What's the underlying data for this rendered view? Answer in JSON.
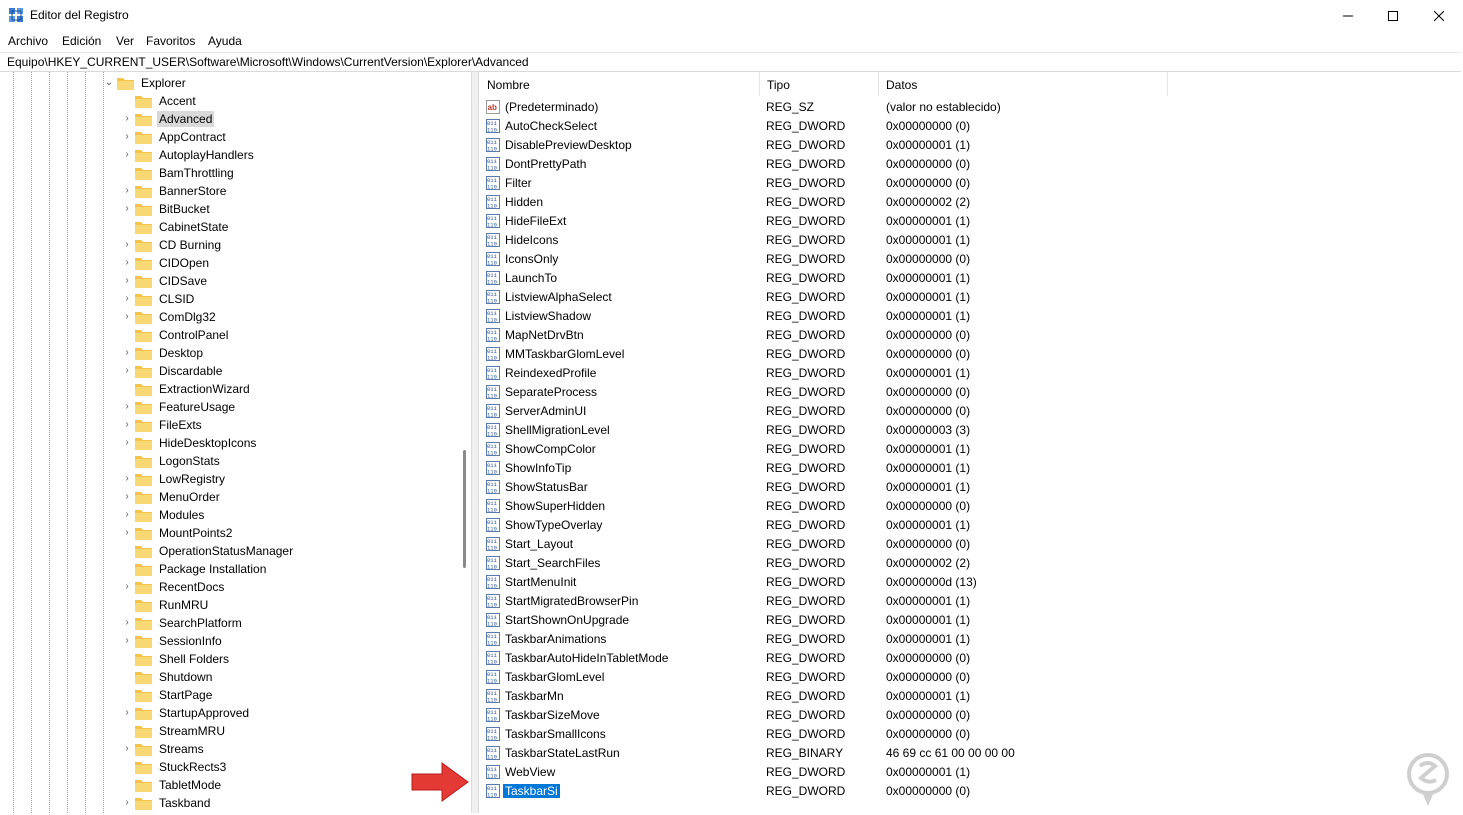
{
  "window": {
    "title": "Editor del Registro",
    "icons": {
      "app": "registry-icon",
      "minimize": "minimize-icon",
      "maximize": "maximize-icon",
      "close": "close-icon"
    }
  },
  "menu": [
    "Archivo",
    "Edición",
    "Ver",
    "Favoritos",
    "Ayuda"
  ],
  "address": "Equipo\\HKEY_CURRENT_USER\\Software\\Microsoft\\Windows\\CurrentVersion\\Explorer\\Advanced",
  "tree": {
    "parent": "Explorer",
    "selected": "Advanced",
    "items": [
      {
        "label": "Accent",
        "expandable": false
      },
      {
        "label": "Advanced",
        "expandable": true
      },
      {
        "label": "AppContract",
        "expandable": true
      },
      {
        "label": "AutoplayHandlers",
        "expandable": true
      },
      {
        "label": "BamThrottling",
        "expandable": false
      },
      {
        "label": "BannerStore",
        "expandable": true
      },
      {
        "label": "BitBucket",
        "expandable": true
      },
      {
        "label": "CabinetState",
        "expandable": false
      },
      {
        "label": "CD Burning",
        "expandable": true
      },
      {
        "label": "CIDOpen",
        "expandable": true
      },
      {
        "label": "CIDSave",
        "expandable": true
      },
      {
        "label": "CLSID",
        "expandable": true
      },
      {
        "label": "ComDlg32",
        "expandable": true
      },
      {
        "label": "ControlPanel",
        "expandable": false
      },
      {
        "label": "Desktop",
        "expandable": true
      },
      {
        "label": "Discardable",
        "expandable": true
      },
      {
        "label": "ExtractionWizard",
        "expandable": false
      },
      {
        "label": "FeatureUsage",
        "expandable": true
      },
      {
        "label": "FileExts",
        "expandable": true
      },
      {
        "label": "HideDesktopIcons",
        "expandable": true
      },
      {
        "label": "LogonStats",
        "expandable": false
      },
      {
        "label": "LowRegistry",
        "expandable": true
      },
      {
        "label": "MenuOrder",
        "expandable": true
      },
      {
        "label": "Modules",
        "expandable": true
      },
      {
        "label": "MountPoints2",
        "expandable": true
      },
      {
        "label": "OperationStatusManager",
        "expandable": false
      },
      {
        "label": "Package Installation",
        "expandable": false
      },
      {
        "label": "RecentDocs",
        "expandable": true
      },
      {
        "label": "RunMRU",
        "expandable": false
      },
      {
        "label": "SearchPlatform",
        "expandable": true
      },
      {
        "label": "SessionInfo",
        "expandable": true
      },
      {
        "label": "Shell Folders",
        "expandable": false
      },
      {
        "label": "Shutdown",
        "expandable": false
      },
      {
        "label": "StartPage",
        "expandable": false
      },
      {
        "label": "StartupApproved",
        "expandable": true
      },
      {
        "label": "StreamMRU",
        "expandable": false
      },
      {
        "label": "Streams",
        "expandable": true
      },
      {
        "label": "StuckRects3",
        "expandable": false
      },
      {
        "label": "TabletMode",
        "expandable": false
      },
      {
        "label": "Taskband",
        "expandable": true
      }
    ]
  },
  "list": {
    "columns": [
      "Nombre",
      "Tipo",
      "Datos"
    ],
    "rows": [
      {
        "name": "(Predeterminado)",
        "type": "REG_SZ",
        "data": "(valor no establecido)",
        "icon": "string-value-icon"
      },
      {
        "name": "AutoCheckSelect",
        "type": "REG_DWORD",
        "data": "0x00000000 (0)",
        "icon": "binary-value-icon"
      },
      {
        "name": "DisablePreviewDesktop",
        "type": "REG_DWORD",
        "data": "0x00000001 (1)",
        "icon": "binary-value-icon"
      },
      {
        "name": "DontPrettyPath",
        "type": "REG_DWORD",
        "data": "0x00000000 (0)",
        "icon": "binary-value-icon"
      },
      {
        "name": "Filter",
        "type": "REG_DWORD",
        "data": "0x00000000 (0)",
        "icon": "binary-value-icon"
      },
      {
        "name": "Hidden",
        "type": "REG_DWORD",
        "data": "0x00000002 (2)",
        "icon": "binary-value-icon"
      },
      {
        "name": "HideFileExt",
        "type": "REG_DWORD",
        "data": "0x00000001 (1)",
        "icon": "binary-value-icon"
      },
      {
        "name": "HideIcons",
        "type": "REG_DWORD",
        "data": "0x00000001 (1)",
        "icon": "binary-value-icon"
      },
      {
        "name": "IconsOnly",
        "type": "REG_DWORD",
        "data": "0x00000000 (0)",
        "icon": "binary-value-icon"
      },
      {
        "name": "LaunchTo",
        "type": "REG_DWORD",
        "data": "0x00000001 (1)",
        "icon": "binary-value-icon"
      },
      {
        "name": "ListviewAlphaSelect",
        "type": "REG_DWORD",
        "data": "0x00000001 (1)",
        "icon": "binary-value-icon"
      },
      {
        "name": "ListviewShadow",
        "type": "REG_DWORD",
        "data": "0x00000001 (1)",
        "icon": "binary-value-icon"
      },
      {
        "name": "MapNetDrvBtn",
        "type": "REG_DWORD",
        "data": "0x00000000 (0)",
        "icon": "binary-value-icon"
      },
      {
        "name": "MMTaskbarGlomLevel",
        "type": "REG_DWORD",
        "data": "0x00000000 (0)",
        "icon": "binary-value-icon"
      },
      {
        "name": "ReindexedProfile",
        "type": "REG_DWORD",
        "data": "0x00000001 (1)",
        "icon": "binary-value-icon"
      },
      {
        "name": "SeparateProcess",
        "type": "REG_DWORD",
        "data": "0x00000000 (0)",
        "icon": "binary-value-icon"
      },
      {
        "name": "ServerAdminUI",
        "type": "REG_DWORD",
        "data": "0x00000000 (0)",
        "icon": "binary-value-icon"
      },
      {
        "name": "ShellMigrationLevel",
        "type": "REG_DWORD",
        "data": "0x00000003 (3)",
        "icon": "binary-value-icon"
      },
      {
        "name": "ShowCompColor",
        "type": "REG_DWORD",
        "data": "0x00000001 (1)",
        "icon": "binary-value-icon"
      },
      {
        "name": "ShowInfoTip",
        "type": "REG_DWORD",
        "data": "0x00000001 (1)",
        "icon": "binary-value-icon"
      },
      {
        "name": "ShowStatusBar",
        "type": "REG_DWORD",
        "data": "0x00000001 (1)",
        "icon": "binary-value-icon"
      },
      {
        "name": "ShowSuperHidden",
        "type": "REG_DWORD",
        "data": "0x00000000 (0)",
        "icon": "binary-value-icon"
      },
      {
        "name": "ShowTypeOverlay",
        "type": "REG_DWORD",
        "data": "0x00000001 (1)",
        "icon": "binary-value-icon"
      },
      {
        "name": "Start_Layout",
        "type": "REG_DWORD",
        "data": "0x00000000 (0)",
        "icon": "binary-value-icon"
      },
      {
        "name": "Start_SearchFiles",
        "type": "REG_DWORD",
        "data": "0x00000002 (2)",
        "icon": "binary-value-icon"
      },
      {
        "name": "StartMenuInit",
        "type": "REG_DWORD",
        "data": "0x0000000d (13)",
        "icon": "binary-value-icon"
      },
      {
        "name": "StartMigratedBrowserPin",
        "type": "REG_DWORD",
        "data": "0x00000001 (1)",
        "icon": "binary-value-icon"
      },
      {
        "name": "StartShownOnUpgrade",
        "type": "REG_DWORD",
        "data": "0x00000001 (1)",
        "icon": "binary-value-icon"
      },
      {
        "name": "TaskbarAnimations",
        "type": "REG_DWORD",
        "data": "0x00000001 (1)",
        "icon": "binary-value-icon"
      },
      {
        "name": "TaskbarAutoHideInTabletMode",
        "type": "REG_DWORD",
        "data": "0x00000000 (0)",
        "icon": "binary-value-icon"
      },
      {
        "name": "TaskbarGlomLevel",
        "type": "REG_DWORD",
        "data": "0x00000000 (0)",
        "icon": "binary-value-icon"
      },
      {
        "name": "TaskbarMn",
        "type": "REG_DWORD",
        "data": "0x00000001 (1)",
        "icon": "binary-value-icon"
      },
      {
        "name": "TaskbarSizeMove",
        "type": "REG_DWORD",
        "data": "0x00000000 (0)",
        "icon": "binary-value-icon"
      },
      {
        "name": "TaskbarSmallIcons",
        "type": "REG_DWORD",
        "data": "0x00000000 (0)",
        "icon": "binary-value-icon"
      },
      {
        "name": "TaskbarStateLastRun",
        "type": "REG_BINARY",
        "data": "46 69 cc 61 00 00 00 00",
        "icon": "binary-value-icon"
      },
      {
        "name": "WebView",
        "type": "REG_DWORD",
        "data": "0x00000001 (1)",
        "icon": "binary-value-icon"
      },
      {
        "name": "TaskbarSi",
        "type": "REG_DWORD",
        "data": "0x00000000 (0)",
        "icon": "binary-value-icon"
      }
    ],
    "selected": "TaskbarSi"
  },
  "annotation": {
    "arrow_icon": "red-arrow-icon",
    "arrow_color": "#e53935"
  },
  "watermark": {
    "icon": "solvetic-logo-icon",
    "color": "#c8c8c8"
  },
  "colors": {
    "selection": "#0078d7",
    "folder": "#f3c34b",
    "tree_selection": "#d9d9d9"
  }
}
